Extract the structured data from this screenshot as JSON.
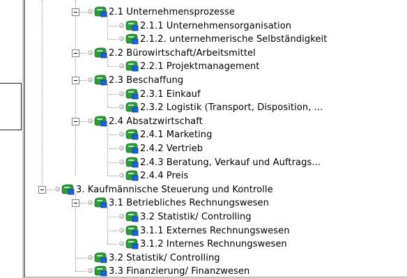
{
  "tree": {
    "nodes": [
      {
        "label": "2.1 Unternehmensprozesse",
        "level": 1,
        "expanded": true,
        "icon": "node-icon"
      },
      {
        "label": "2.1.1 Unternehmensorganisation",
        "level": 2,
        "icon": "node-icon"
      },
      {
        "label": "2.1.2. unternehmerische Selbständigkeit",
        "level": 2,
        "icon": "node-icon"
      },
      {
        "label": "2.2 Bürowirtschaft/Arbeitsmittel",
        "level": 1,
        "expanded": true,
        "icon": "node-icon"
      },
      {
        "label": "2.2.1 Projektmanagement",
        "level": 2,
        "icon": "node-icon"
      },
      {
        "label": "2.3 Beschaffung",
        "level": 1,
        "expanded": true,
        "icon": "node-icon"
      },
      {
        "label": "2.3.1 Einkauf",
        "level": 2,
        "icon": "node-icon"
      },
      {
        "label": "2.3.2 Logistik (Transport, Disposition, ...",
        "level": 2,
        "icon": "node-icon"
      },
      {
        "label": "2.4 Absatzwirtschaft",
        "level": 1,
        "expanded": true,
        "icon": "node-icon"
      },
      {
        "label": "2.4.1 Marketing",
        "level": 2,
        "icon": "node-icon"
      },
      {
        "label": "2.4.2 Vertrieb",
        "level": 2,
        "icon": "node-icon"
      },
      {
        "label": "2.4.3 Beratung, Verkauf und Auftrags...",
        "level": 2,
        "icon": "node-icon"
      },
      {
        "label": "2.4.4 Preis",
        "level": 2,
        "icon": "node-icon"
      },
      {
        "label": "3. Kaufmännische Steuerung und Kontrolle",
        "level": 0,
        "expanded": true,
        "icon": "node-icon"
      },
      {
        "label": "3.1 Betriebliches Rechnungswesen",
        "level": 1,
        "expanded": true,
        "icon": "node-icon"
      },
      {
        "label": "3.2 Statistik/ Controlling",
        "level": 2,
        "icon": "node-icon"
      },
      {
        "label": "3.1.1 Externes Rechnungswesen",
        "level": 2,
        "icon": "node-icon"
      },
      {
        "label": "3.1.2 Internes Rechnungswesen",
        "level": 2,
        "icon": "node-icon"
      },
      {
        "label": "3.2 Statistik/ Controlling",
        "level": 1,
        "icon": "node-icon"
      },
      {
        "label": "3.3 Finanzierung/ Finanzwesen",
        "level": 1,
        "icon": "node-icon"
      }
    ]
  },
  "colors": {
    "icon_green": "#2e9a3a",
    "icon_blue": "#1565d8",
    "connector": "#9a9a9a"
  }
}
